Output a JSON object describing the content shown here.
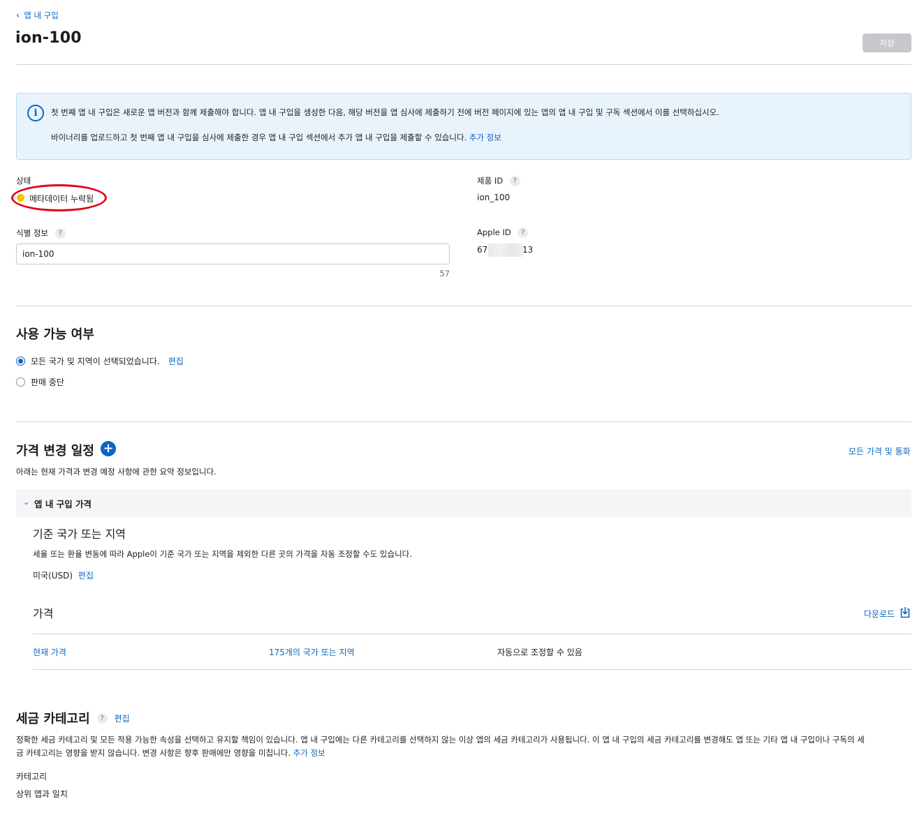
{
  "header": {
    "back_label": "앱 내 구입",
    "title": "ion-100",
    "save_label": "저장"
  },
  "info": {
    "line1": "첫 번째 앱 내 구입은 새로운 앱 버전과 함께 제출해야 합니다. 앱 내 구입을 생성한 다음, 해당 버전을 앱 심사에 제출하기 전에 버전 페이지에 있는 앱의 앱 내 구입 및 구독 섹션에서 이를 선택하십시오.",
    "line2": "바이너리를 업로드하고 첫 번째 앱 내 구입을 심사에 제출한 경우 앱 내 구입 섹션에서 추가 앱 내 구입을 제출할 수 있습니다.",
    "more_link": "추가 정보",
    "icon": "info-circle-icon"
  },
  "details": {
    "status_label": "상태",
    "status_value": "메타데이터 누락됨",
    "status_color": "#f5c400",
    "reference_label": "식별 정보",
    "reference_value": "ion-100",
    "reference_counter": "57",
    "product_id_label": "제품 ID",
    "product_id_value": "ion_100",
    "apple_id_label": "Apple ID",
    "apple_id_prefix": "67",
    "apple_id_suffix": "13",
    "help_glyph": "?"
  },
  "availability": {
    "title": "사용 가능 여부",
    "option_all": "모든 국가 및 지역이 선택되었습니다.",
    "edit_label": "편집",
    "option_removed": "판매 중단"
  },
  "price_schedule": {
    "title": "가격 변경 일정",
    "all_prices_link": "모든 가격 및 통화",
    "summary": "아래는 현재 가격과 변경 예정 사항에 관한 요약 정보입니다.",
    "accordion_label": "앱 내 구입 가격",
    "base_title": "기준 국가 또는 지역",
    "base_desc": "세율 또는 환율 변동에 따라 Apple이 기준 국가 또는 지역을 제외한 다른 곳의 가격을 자동 조정할 수도 있습니다.",
    "base_value": "미국(USD)",
    "base_edit": "편집",
    "price_title": "가격",
    "download_label": "다운로드",
    "row": {
      "current_price": "현재 가격",
      "regions": "175개의 국가 또는 지역",
      "auto_adjust": "자동으로 조정할 수 있음"
    }
  },
  "tax": {
    "title": "세금 카테고리",
    "edit_label": "편집",
    "desc_line1": "정확한 세금 카테고리 및 모든 적용 가능한 속성을 선택하고 유지할 책임이 있습니다. 앱 내 구입에는 다른 카테고리를 선택하지 않는 이상 앱의 세금 카테고리가 사용됩니다. 이 앱 내 구입의 세금 카테고리를 변경해도 앱 또는 기타 앱 내 구입이나 구독의 세",
    "desc_line2": "금 카테고리는 영향을 받지 않습니다. 변경 사항은 향후 판매에만 영향을 미칩니다.",
    "more_link": "추가 정보",
    "category_label": "카테고리",
    "category_value": "상위 앱과 일치"
  },
  "colors": {
    "accent": "#0a66c2",
    "info_bg": "#e8f3fc",
    "highlight": "#e0001a"
  }
}
